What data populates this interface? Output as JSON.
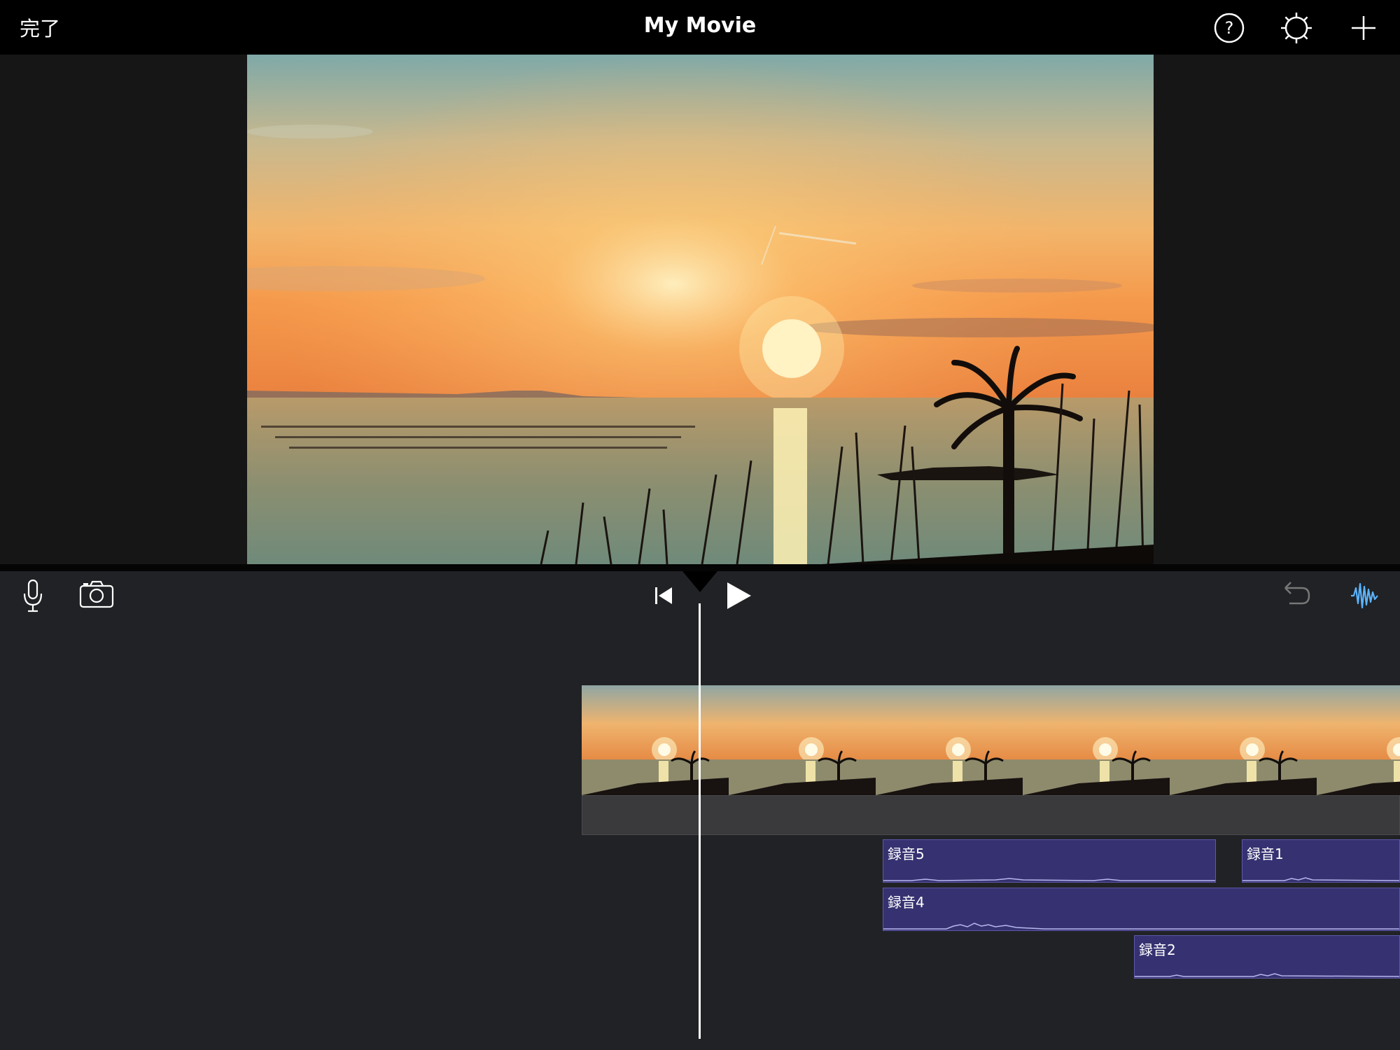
{
  "header": {
    "done_label": "完了",
    "title": "My Movie",
    "icons": [
      "help-icon",
      "gear-icon",
      "plus-icon"
    ]
  },
  "toolbar": {
    "icons": [
      "microphone-icon",
      "camera-icon",
      "skip-to-start-icon",
      "play-icon",
      "undo-icon",
      "audio-waveform-icon"
    ],
    "accent_color": "#5ab4ff"
  },
  "timeline": {
    "video_clip": {
      "thumbnail_count": 6
    },
    "audio_clips": [
      {
        "label": "録音5"
      },
      {
        "label": "録音1"
      },
      {
        "label": "録音4"
      },
      {
        "label": "録音2"
      }
    ],
    "audio_clip_color": "#363271"
  }
}
